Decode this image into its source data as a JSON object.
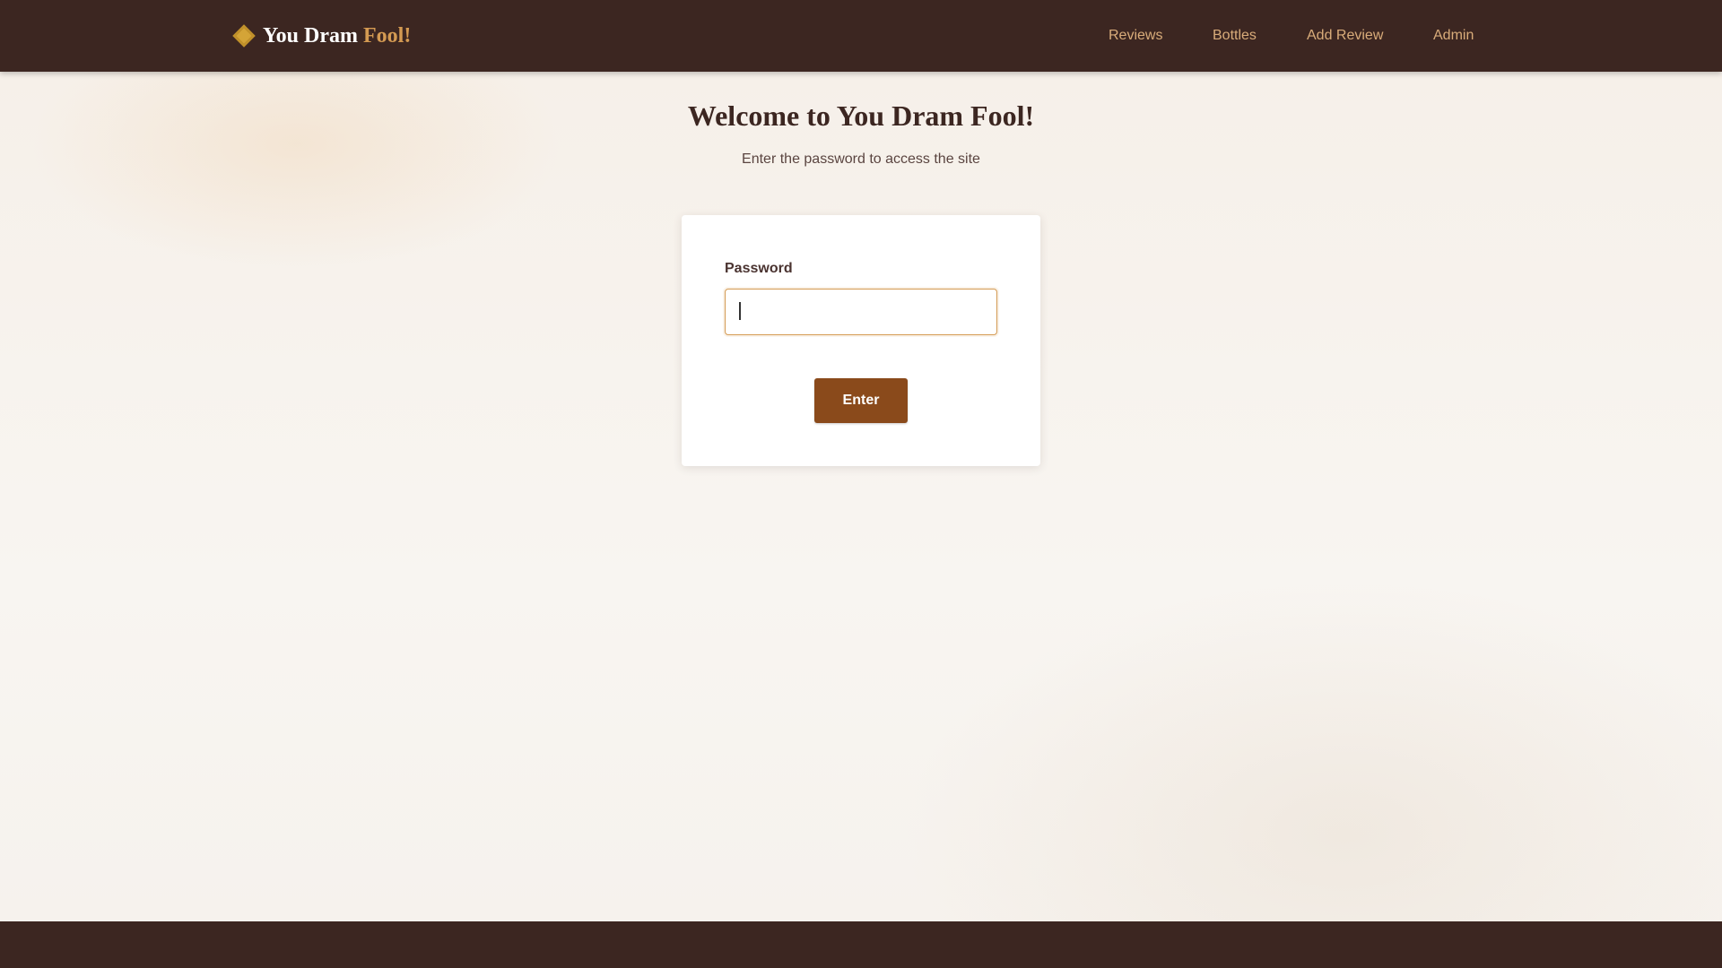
{
  "header": {
    "logo": {
      "icon": "diamond-icon",
      "text_main": "You Dram ",
      "text_accent": "Fool!"
    },
    "nav": [
      {
        "label": "Reviews"
      },
      {
        "label": "Bottles"
      },
      {
        "label": "Add Review"
      },
      {
        "label": "Admin"
      }
    ]
  },
  "main": {
    "title": "Welcome to You Dram Fool!",
    "subtitle": "Enter the password to access the site",
    "form": {
      "password_label": "Password",
      "password_value": "",
      "submit_label": "Enter"
    }
  },
  "colors": {
    "header_bg": "#3c2621",
    "nav_link": "#d9ac7a",
    "logo_accent": "#d49a52",
    "button_bg": "#8a4a1b",
    "page_bg": "#f7f3ee"
  }
}
